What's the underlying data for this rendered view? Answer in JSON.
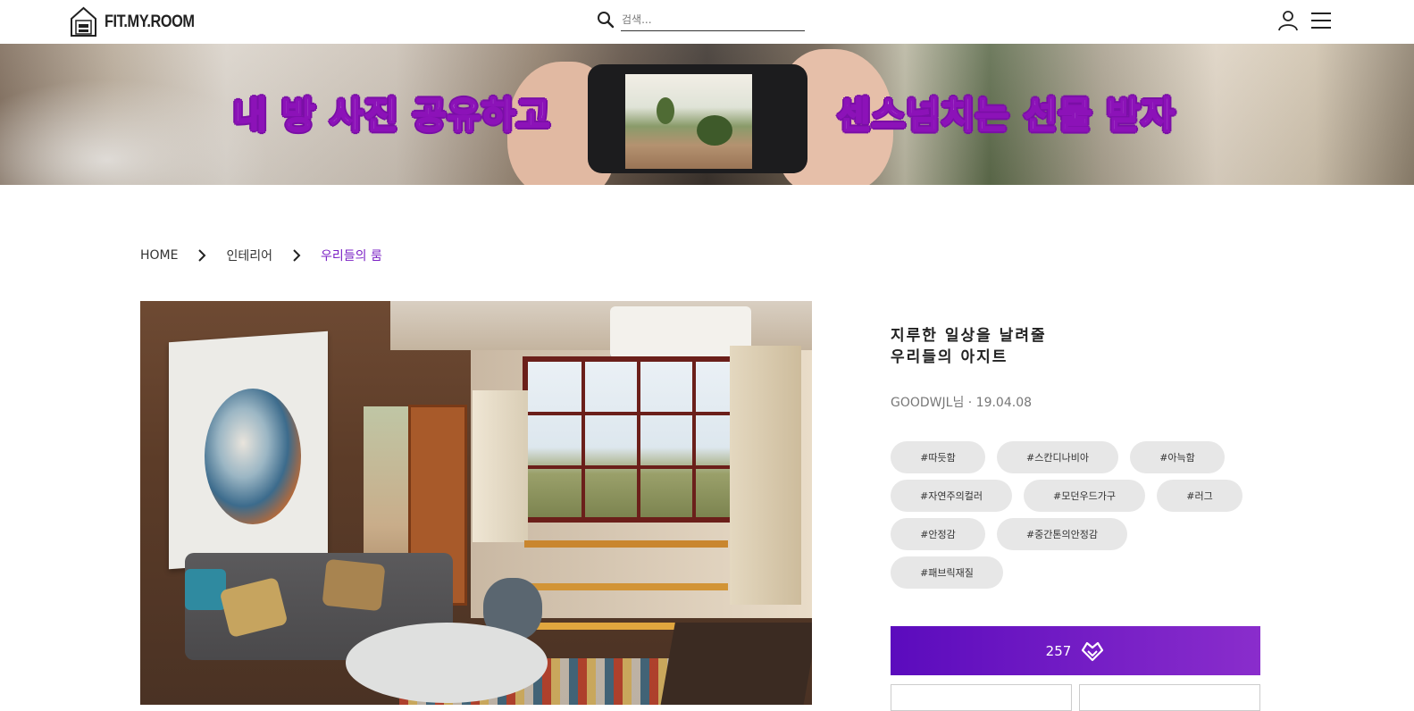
{
  "header": {
    "logo_text": "FIT.MY.ROOM",
    "search_placeholder": "검색...",
    "icons": [
      "search-icon",
      "user-icon",
      "hamburger-menu-icon"
    ]
  },
  "banner": {
    "left_text": "내 방 사진 공유하고",
    "right_text": "센스넘치는 선물 받자",
    "accent": "#7a0fa6"
  },
  "breadcrumb": {
    "items": [
      "HOME",
      "인테리어"
    ],
    "current": "우리들의 룸"
  },
  "post": {
    "title_line1": "지루한 일상을 날려줄",
    "title_line2": "우리들의 아지트",
    "author": "GOODWJL님 · 19.04.08",
    "tags": {
      "row1": [
        "#따듯함",
        "#스칸디나비아",
        "#아늑함"
      ],
      "row2": [
        "#자연주의컬러",
        "#모던우드가구",
        "#러그"
      ],
      "row3": [
        "#안정감",
        "#중간톤의안정감"
      ],
      "row4": [
        "#패브릭재질"
      ]
    },
    "like_count": "257"
  },
  "colors": {
    "primary": "#5b0bbd",
    "primary_end": "#8a2dcc",
    "breadcrumb_current": "#7a20c4",
    "tag_bg": "#e7e7e7"
  }
}
